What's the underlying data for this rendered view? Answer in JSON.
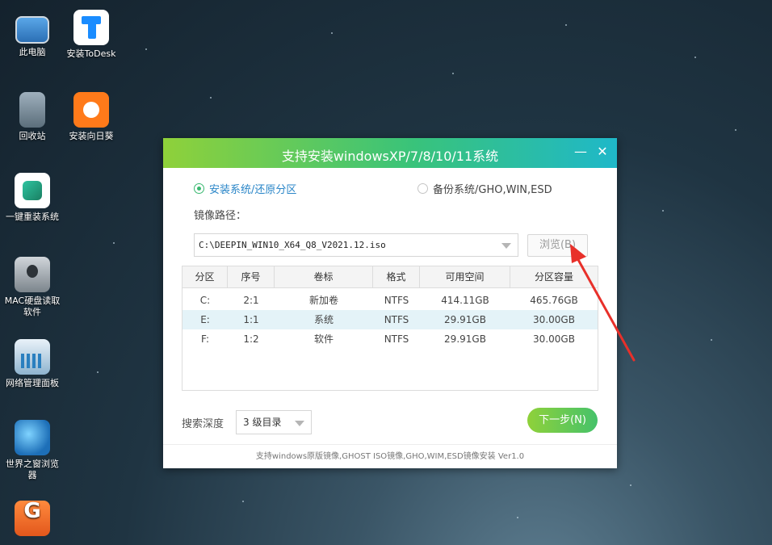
{
  "desktop": {
    "icons": [
      {
        "label": "此电脑",
        "icon": "computer-icon"
      },
      {
        "label": "安装ToDesk",
        "icon": "todesk-icon"
      },
      {
        "label": "回收站",
        "icon": "recycle-bin-icon"
      },
      {
        "label": "安装向日葵",
        "icon": "sunflower-icon"
      },
      {
        "label": "一键重装系统",
        "icon": "onekey-reinstall-icon"
      },
      {
        "label": "MAC硬盘读取软件",
        "icon": "mac-disk-icon"
      },
      {
        "label": "网络管理面板",
        "icon": "network-panel-icon"
      },
      {
        "label": "世界之窗浏览器",
        "icon": "browser-icon"
      },
      {
        "label": "",
        "icon": "g-app-icon"
      }
    ]
  },
  "dialog": {
    "title": "支持安装windowsXP/7/8/10/11系统",
    "minimize": "—",
    "close": "✕",
    "option_install": "安装系统/还原分区",
    "option_backup": "备份系统/GHO,WIN,ESD",
    "image_path_label": "镜像路径：",
    "image_path_value": "C:\\DEEPIN_WIN10_X64_Q8_V2021.12.iso",
    "browse_label": "浏览(B)",
    "table": {
      "headers": [
        "分区",
        "序号",
        "卷标",
        "格式",
        "可用空间",
        "分区容量"
      ],
      "rows": [
        [
          "C:",
          "2:1",
          "新加卷",
          "NTFS",
          "414.11GB",
          "465.76GB"
        ],
        [
          "E:",
          "1:1",
          "系统",
          "NTFS",
          "29.91GB",
          "30.00GB"
        ],
        [
          "F:",
          "1:2",
          "软件",
          "NTFS",
          "29.91GB",
          "30.00GB"
        ]
      ],
      "selected_row": 1
    },
    "search_depth_label": "搜索深度",
    "search_depth_value": "3 级目录",
    "next_label": "下一步(N)",
    "footer": "支持windows原版镜像,GHOST ISO镜像,GHO,WIM,ESD镜像安装 Ver1.0"
  },
  "colors": {
    "title_gradient_start": "#8fd13a",
    "title_gradient_end": "#1fb8c9",
    "accent_blue": "#2a86c8",
    "selected_row": "#e4f3f8",
    "annotation_arrow": "#e8302a"
  }
}
